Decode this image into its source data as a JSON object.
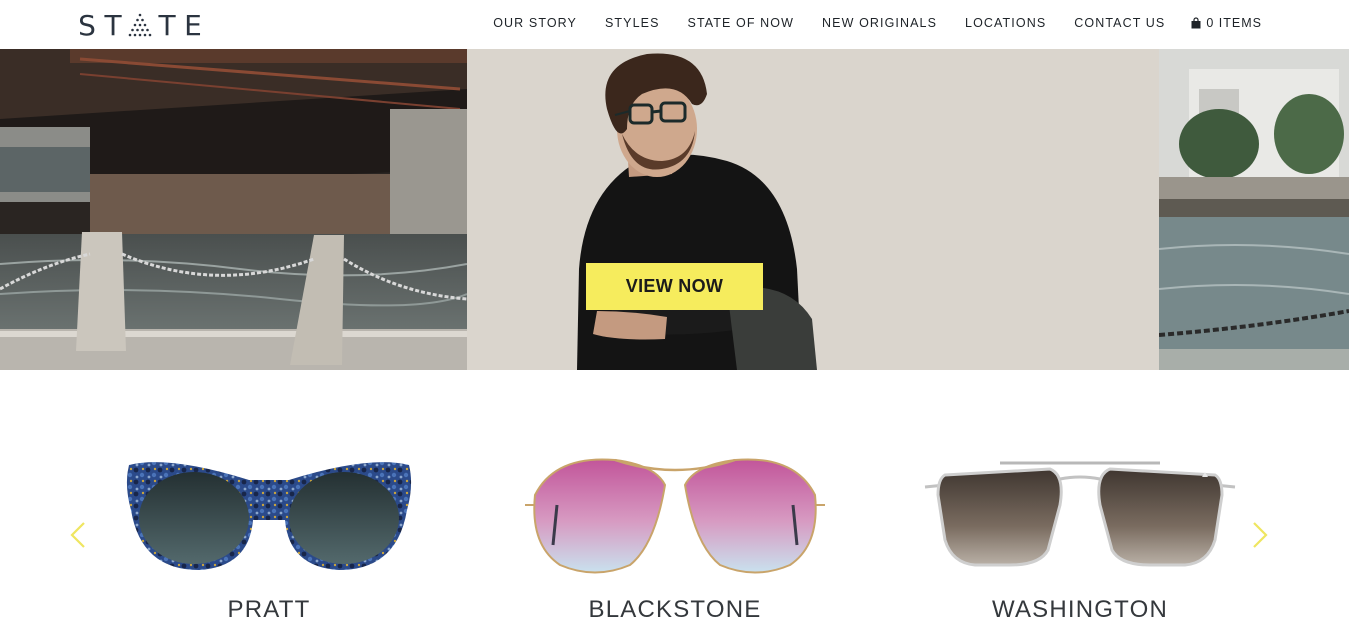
{
  "header": {
    "logo": {
      "letters_left": "ST",
      "letters_right": "TE",
      "alt": "STATE"
    },
    "nav": [
      {
        "label": "OUR STORY"
      },
      {
        "label": "STYLES"
      },
      {
        "label": "STATE OF NOW"
      },
      {
        "label": "NEW ORIGINALS"
      },
      {
        "label": "LOCATIONS"
      },
      {
        "label": "CONTACT US"
      }
    ],
    "cart": {
      "label": "0 ITEMS",
      "icon": "bag-icon"
    }
  },
  "hero": {
    "cta_label": "VIEW NOW",
    "cta_color": "#f6ec5d"
  },
  "products": {
    "items": [
      {
        "name": "PRATT"
      },
      {
        "name": "BLACKSTONE"
      },
      {
        "name": "WASHINGTON"
      }
    ],
    "arrow_color": "#efe660",
    "prev_icon": "chevron-left-icon",
    "next_icon": "chevron-right-icon"
  }
}
